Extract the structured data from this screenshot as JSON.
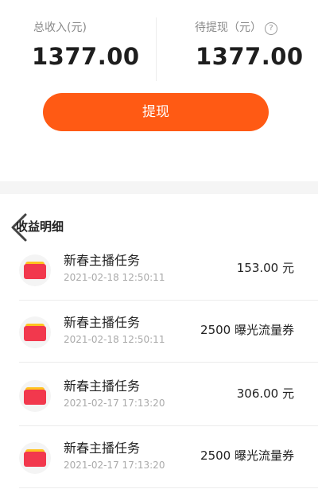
{
  "summary": {
    "total_income_label": "总收入(元)",
    "total_income_value": "1377.00",
    "pending_label": "待提现（元）",
    "pending_value": "1377.00",
    "help_glyph": "?"
  },
  "withdraw_button": {
    "label": "提现"
  },
  "details": {
    "title": "收益明细",
    "back_icon": "chevron-left-icon",
    "items": [
      {
        "title": "新春主播任务",
        "time": "2021-02-18 12:50:11",
        "amount": "153.00 元",
        "icon": "wallet-icon"
      },
      {
        "title": "新春主播任务",
        "time": "2021-02-18 12:50:11",
        "amount": "2500 曝光流量券",
        "icon": "wallet-icon"
      },
      {
        "title": "新春主播任务",
        "time": "2021-02-17 17:13:20",
        "amount": "306.00 元",
        "icon": "wallet-icon"
      },
      {
        "title": "新春主播任务",
        "time": "2021-02-17 17:13:20",
        "amount": "2500 曝光流量券",
        "icon": "wallet-icon"
      }
    ]
  },
  "colors": {
    "accent": "#ff5a14",
    "wallet_red": "#f2384d",
    "wallet_yellow": "#ffc21f"
  }
}
